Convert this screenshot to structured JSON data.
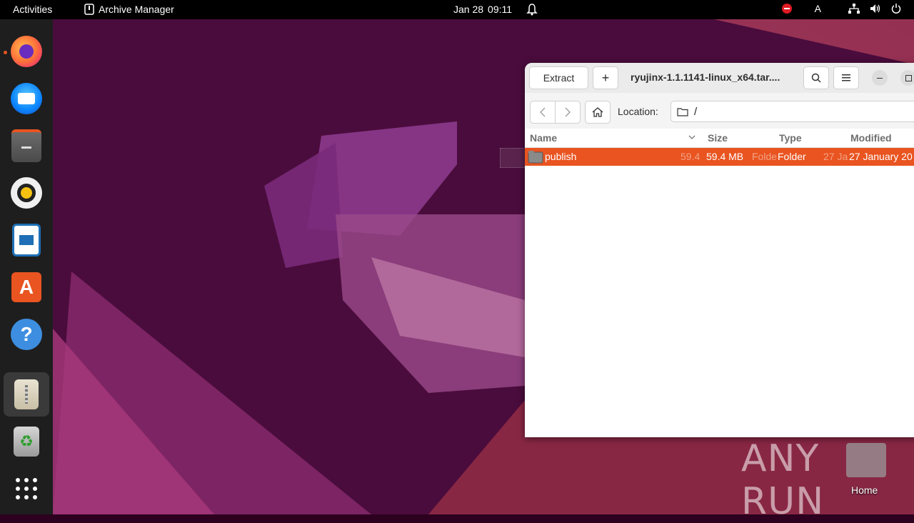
{
  "topbar": {
    "activities": "Activities",
    "app_name": "Archive Manager",
    "date": "Jan 28",
    "time": "09:11",
    "keyboard": "A"
  },
  "dock": {
    "items": [
      {
        "name": "firefox",
        "running": true
      },
      {
        "name": "thunderbird",
        "running": false
      },
      {
        "name": "files",
        "running": false
      },
      {
        "name": "rhythmbox",
        "running": false
      },
      {
        "name": "libreoffice-writer",
        "running": false
      },
      {
        "name": "app-center",
        "running": false
      },
      {
        "name": "help",
        "running": false
      },
      {
        "name": "archive-manager",
        "running": true,
        "active": true
      },
      {
        "name": "trash",
        "running": false
      },
      {
        "name": "show-apps",
        "running": false
      }
    ]
  },
  "window": {
    "extract_label": "Extract",
    "add_label": "+",
    "title": "ryujinx-1.1.1141-linux_x64.tar....",
    "location_label": "Location:",
    "location_value": "/",
    "columns": {
      "name": "Name",
      "size": "Size",
      "type": "Type",
      "modified": "Modified"
    },
    "rows": [
      {
        "name": "publish",
        "size": "59.4 MB",
        "type": "Folder",
        "modified": "27 January 20",
        "ghost_size": "59.4",
        "ghost_type": "Folde",
        "ghost_modified": "27 Ja"
      }
    ]
  },
  "desktop": {
    "home_label": "Home",
    "watermark": "ANY RUN"
  },
  "colors": {
    "accent": "#e95420",
    "topbar": "#000000",
    "dock": "#1e1e1e"
  }
}
